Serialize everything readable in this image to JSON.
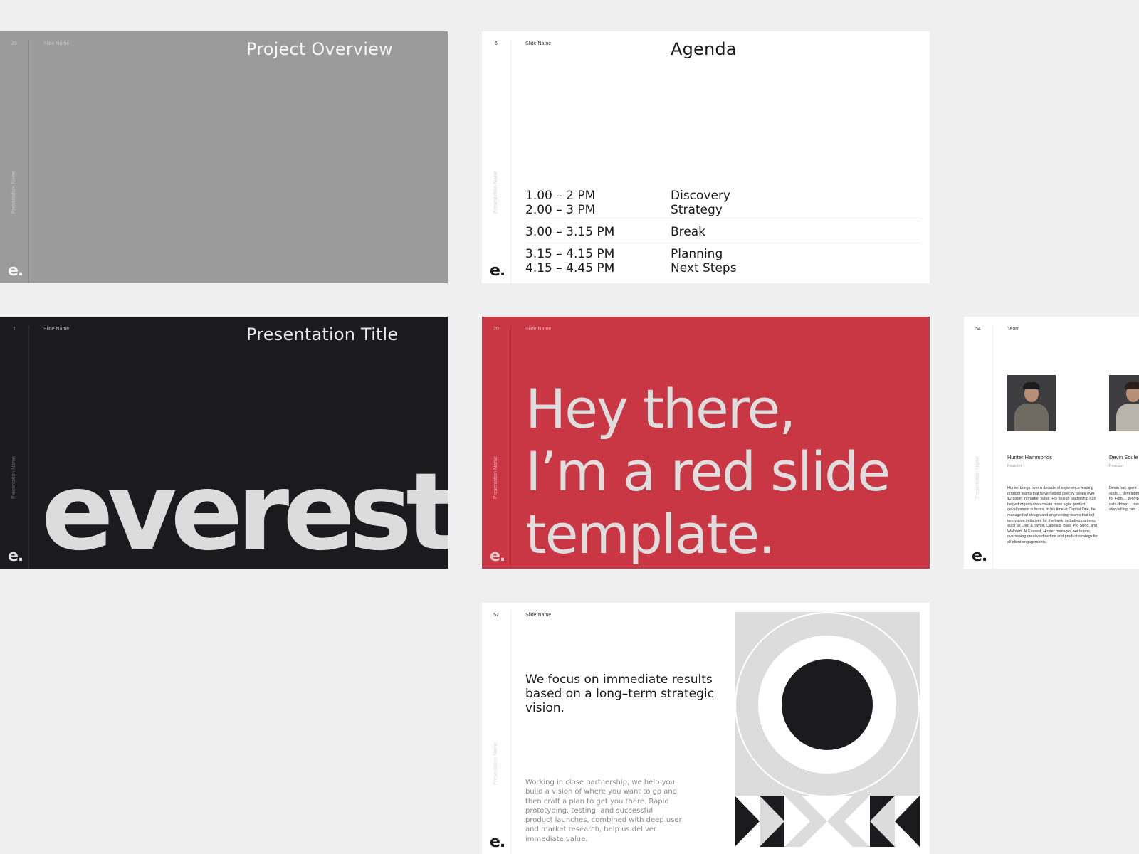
{
  "canvas": {
    "background": "#efefef"
  },
  "slides": {
    "gray": {
      "number": "25",
      "slide_name": "Slide Name",
      "presentation_name": "Presentation Name",
      "title": "Project Overview",
      "logo": "e.",
      "background": "#9b9b9b"
    },
    "agenda": {
      "number": "6",
      "slide_name": "Slide Name",
      "presentation_name": "Presentation Name",
      "title": "Agenda",
      "logo": "e.",
      "groups": [
        {
          "items": [
            {
              "time": "1.00 – 2 PM",
              "label": "Discovery"
            },
            {
              "time": "2.00 – 3 PM",
              "label": "Strategy"
            }
          ]
        },
        {
          "items": [
            {
              "time": "3.00 – 3.15 PM",
              "label": "Break"
            }
          ]
        },
        {
          "items": [
            {
              "time": "3.15 – 4.15 PM",
              "label": "Planning"
            },
            {
              "time": "4.15 – 4.45 PM",
              "label": "Next Steps"
            }
          ]
        }
      ]
    },
    "dark": {
      "number": "1",
      "slide_name": "Slide Name",
      "presentation_name": "Presentation Name",
      "title": "Presentation Title",
      "wordmark": "everest.",
      "logo": "e.",
      "background": "#1b1b1d"
    },
    "red": {
      "number": "20",
      "slide_name": "Slide Name",
      "presentation_name": "Presentation Name",
      "headline_lines": [
        "Hey there,",
        "I’m a red slide",
        "template."
      ],
      "logo": "e.",
      "background": "#c93745"
    },
    "team": {
      "number": "54",
      "slide_name": "Team",
      "presentation_name": "Presentation Name",
      "logo": "e.",
      "members": [
        {
          "name": "Hunter Hammonds",
          "role": "Founder",
          "bio": "Hunter brings over a decade of experience leading product teams that have helped directly create over $2 billion in market value. His design leadership has helped organization create more agile product development cultures. In his time at Capital One, he managed all design and engineering teams that led innovation initiatives for the bank, including partners such as Lord & Taylor, Cabela's, Bass Pro Shop, and Walmart. At Everest, Hunter manages our teams, overseeing creative direction and product strategy for all client engagements."
        },
        {
          "name": "Devin Soule",
          "role": "Founder",
          "bio": "Devin has spent ... growing digital ... stages. In additi... development an... stage companie... design for Fortu... Whirlpool. For E... and brand strat... and data-driven... passion is helpi... market fit throu... storytelling, pro... business design"
        }
      ]
    },
    "vision": {
      "number": "57",
      "slide_name": "Slide Name",
      "presentation_name": "Presentation Name",
      "headline": "We focus on immediate results based on a long–term strategic vision.",
      "body": "Working in close partnership, we help you build a vision of where you want to go and then craft a plan to get you there. Rapid prototyping, testing, and successful product launches, combined with deep user and market research, help us deliver immediate value.",
      "logo": "e.",
      "art_colors": {
        "light": "#dcdcdc",
        "dark": "#1b1b1d",
        "white": "#ffffff"
      }
    }
  }
}
